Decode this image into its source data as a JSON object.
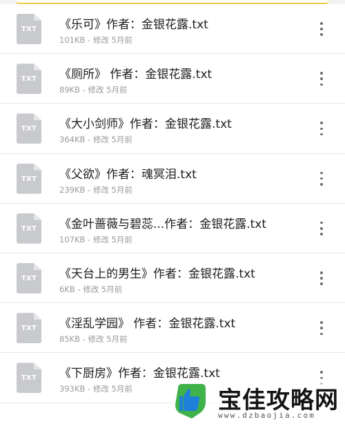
{
  "files": [
    {
      "name": "《乐可》作者：金银花露.txt",
      "meta": "101KB - 修改 5月前",
      "ext": "TXT"
    },
    {
      "name": "《厕所》 作者：金银花露.txt",
      "meta": "89KB - 修改 5月前",
      "ext": "TXT"
    },
    {
      "name": "《大小剑师》作者：金银花露.txt",
      "meta": "364KB - 修改 5月前",
      "ext": "TXT"
    },
    {
      "name": "《父欲》作者：魂冥泪.txt",
      "meta": "239KB - 修改 5月前",
      "ext": "TXT"
    },
    {
      "name": "《金叶蔷薇与碧蕊...作者：金银花露.txt",
      "meta": "107KB - 修改 5月前",
      "ext": "TXT"
    },
    {
      "name": "《天台上的男生》作者：金银花露.txt",
      "meta": "6KB - 修改 5月前",
      "ext": "TXT"
    },
    {
      "name": "《淫乱学园》 作者：金银花露.txt",
      "meta": "85KB - 修改 5月前",
      "ext": "TXT"
    },
    {
      "name": "《下厨房》作者：金银花露.txt",
      "meta": "393KB - 修改 5月前",
      "ext": "TXT"
    }
  ],
  "watermark": {
    "title": "宝佳攻略网",
    "url": "www.dzbaojia.com"
  },
  "colors": {
    "icon_fill": "#c9cacd",
    "divider": "#e7e7e7",
    "meta_text": "#9a9a9a",
    "tab_accent": "#f1c94b",
    "logo_green": "#3fb24a",
    "logo_blue": "#1e7fd8"
  },
  "icons": {
    "file": "txt-file-icon",
    "more": "more-vertical-icon",
    "logo": "thumbs-up-logo"
  }
}
